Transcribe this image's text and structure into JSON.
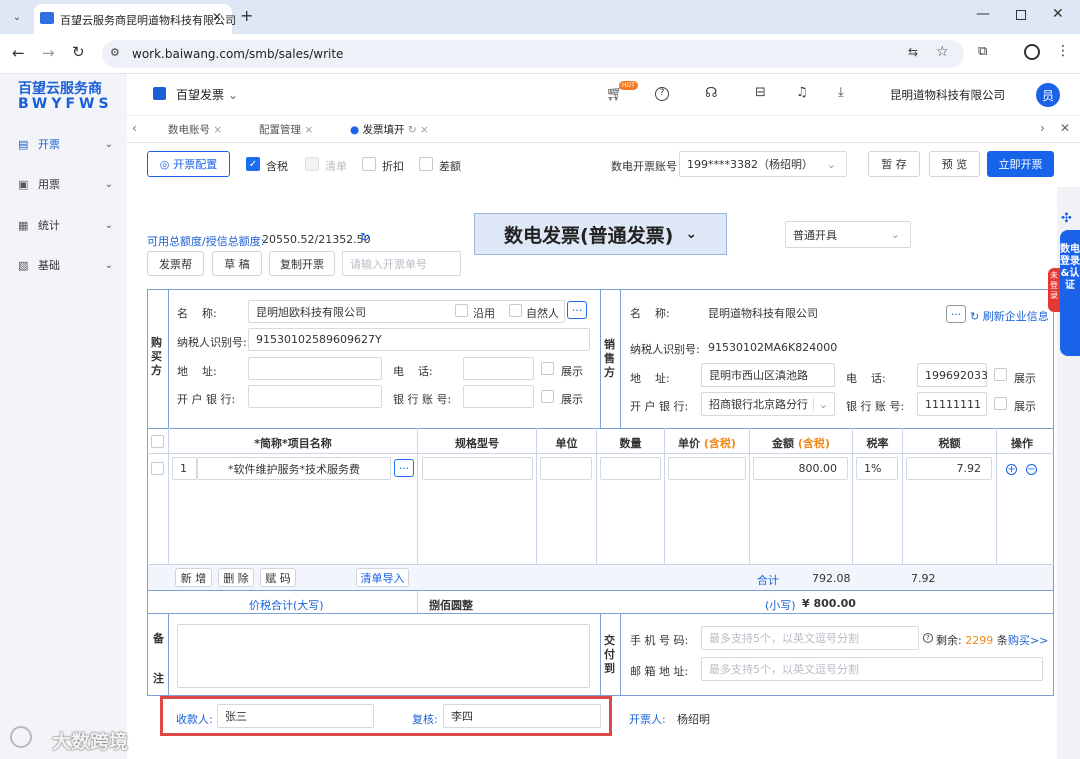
{
  "browser": {
    "tab_title": "百望云服务商昆明道物科技有限公司",
    "url": "work.baiwang.com/smb/sales/write"
  },
  "logo": {
    "line1": "百望云服务商",
    "line2": "BWYFWS"
  },
  "sidebar": {
    "items": [
      {
        "label": "开票",
        "icon": "receipt-icon",
        "active": true
      },
      {
        "label": "用票",
        "icon": "ticket-icon"
      },
      {
        "label": "统计",
        "icon": "chart-icon"
      },
      {
        "label": "基础",
        "icon": "basic-icon"
      }
    ]
  },
  "header": {
    "product": "百望发票",
    "hot_badge": "HOT",
    "company": "昆明道物科技有限公司",
    "avatar": "员"
  },
  "subtabs": [
    {
      "label": "数电账号"
    },
    {
      "label": "配置管理"
    },
    {
      "label": "发票填开",
      "active": true
    }
  ],
  "toolbar": {
    "config_btn": "开票配置",
    "options": [
      {
        "label": "含税",
        "checked": true
      },
      {
        "label": "清单",
        "checked": false,
        "disabled": true
      },
      {
        "label": "折扣",
        "checked": false
      },
      {
        "label": "差额",
        "checked": false
      }
    ],
    "account_label": "数电开票账号",
    "account_value": "199****3382（杨绍明）",
    "save": "暂 存",
    "preview": "预 览",
    "issue": "立即开票"
  },
  "quota": {
    "label": "可用总额度/授信总额度:",
    "value": "20550.52/21352.50"
  },
  "invoice_type": "数电发票(普通发票)",
  "issue_mode": "普通开具",
  "actions": {
    "help": "发票帮",
    "draft": "草 稿",
    "copy": "复制开票",
    "invoice_no_placeholder": "请输入开票单号"
  },
  "buyer": {
    "side_label": "购买方",
    "name_label": "名    称:",
    "name": "昆明旭欧科技有限公司",
    "use_orig": "沿用",
    "natural_person": "自然人",
    "tax_label": "纳税人识别号:",
    "tax_id": "91530102589609627Y",
    "addr_label": "地    址:",
    "phone_label": "电    话:",
    "bank_label": "开 户 银 行:",
    "account_label": "银 行 账 号:",
    "show": "展示"
  },
  "seller": {
    "side_label": "销售方",
    "name_label": "名    称:",
    "name": "昆明道物科技有限公司",
    "refresh": "刷新企业信息",
    "tax_label": "纳税人识别号:",
    "tax_id": "91530102MA6K824000",
    "addr_label": "地    址:",
    "addr": "昆明市西山区滇池路",
    "phone_label": "电    话:",
    "phone": "199692033",
    "bank_label": "开 户 银 行:",
    "bank": "招商银行北京路分行",
    "account_label": "银 行 账 号:",
    "account": "11111111",
    "show": "展示"
  },
  "items_table": {
    "headers": {
      "name": "*简称*项目名称",
      "spec": "规格型号",
      "unit": "单位",
      "qty": "数量",
      "price": "单价",
      "price_note": "(含税)",
      "amount": "金额",
      "amount_note": "(含税)",
      "rate": "税率",
      "tax": "税额",
      "op": "操作"
    },
    "rows": [
      {
        "no": "1",
        "name": "*软件维护服务*技术服务费",
        "amount": "800.00",
        "rate": "1%",
        "tax": "7.92"
      }
    ],
    "footer": {
      "add": "新 增",
      "delete": "删 除",
      "assign_code": "赋 码",
      "import": "清单导入",
      "total_label": "合计",
      "total_amount": "792.08",
      "total_tax": "7.92"
    }
  },
  "totals": {
    "label": "价税合计(大写)",
    "upper": "捌佰圆整",
    "lower_label": "(小写)",
    "lower": "¥ 800.00"
  },
  "remarks": {
    "label_top": "备",
    "label_bottom": "注"
  },
  "delivery": {
    "side_label": "交付到",
    "phone_label": "手 机 号 码:",
    "phone_ph": "最多支持5个，以英文逗号分割",
    "remain_label": "剩余:",
    "remain": "2299",
    "remain_unit": "条",
    "buy": "购买>>",
    "email_label": "邮 箱 地 址:",
    "email_ph": "最多支持5个，以英文逗号分割"
  },
  "signers": {
    "payee_label": "收款人:",
    "payee": "张三",
    "reviewer_label": "复核:",
    "reviewer": "李四",
    "drawer_label": "开票人:",
    "drawer": "杨绍明"
  },
  "floating": {
    "login": "数电登录&认证",
    "not_logged": "未登录"
  },
  "watermark": "大数跨境"
}
